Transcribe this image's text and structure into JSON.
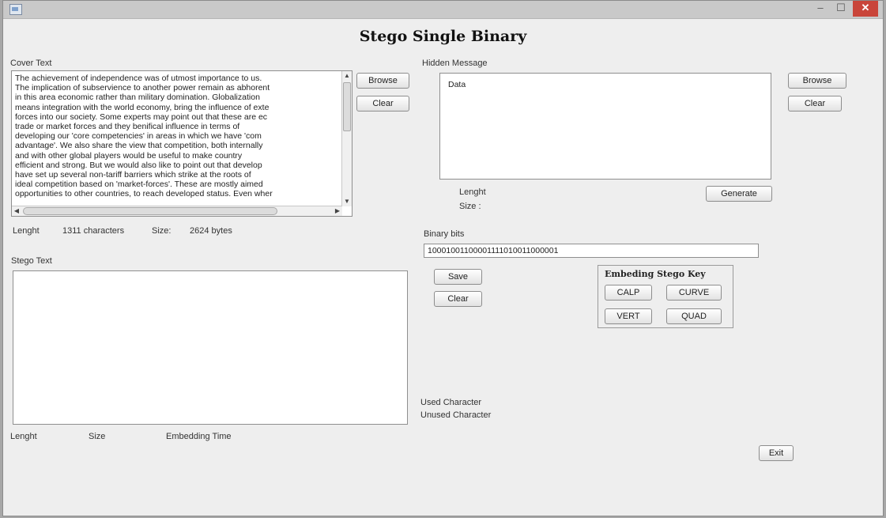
{
  "window": {
    "title": "Stego Single Binary"
  },
  "cover": {
    "label": "Cover Text",
    "text_lines": [
      "The achievement of independence was of utmost importance to us.",
      "The implication of subservience to another power remain as abhorent",
      "in this area economic rather than military domination. Globalization",
      "means integration with the world economy, bring the influence of exte",
      "forces into our society. Some experts may point out that these are ec",
      "trade or market forces and they benifical influence in terms of",
      "developing our 'core competencies' in areas in which we have 'com",
      "advantage'. We also share the view that competition, both internally",
      "and with other global players would be useful to make country",
      "efficient and strong. But we would also like to point out that develop",
      "have set up several non-tariff barriers which strike at the roots of",
      "ideal competition based on 'market-forces'. These are mostly aimed",
      "opportunities to other countries, to reach developed status. Even wher"
    ],
    "browse_label": "Browse",
    "clear_label": "Clear",
    "length_label": "Lenght",
    "length_value": "1311 characters",
    "size_label": "Size:",
    "size_value": "2624 bytes"
  },
  "hidden": {
    "label": "Hidden Message",
    "text": "Data",
    "browse_label": "Browse",
    "clear_label": "Clear",
    "length_label": "Lenght",
    "size_label": "Size :",
    "generate_label": "Generate"
  },
  "binary": {
    "label": "Binary bits",
    "value": "10001001100001111010011000001",
    "save_label": "Save",
    "clear_label": "Clear"
  },
  "stego_key": {
    "title": "Embeding Stego Key",
    "buttons": [
      "CALP",
      "CURVE",
      "VERT",
      "QUAD"
    ]
  },
  "stego": {
    "label": "Stego Text",
    "text": "",
    "length_label": "Lenght",
    "size_label": "Size",
    "time_label": "Embedding Time"
  },
  "stats": {
    "used_label": "Used Character",
    "unused_label": "Unused Character"
  },
  "exit_label": "Exit"
}
